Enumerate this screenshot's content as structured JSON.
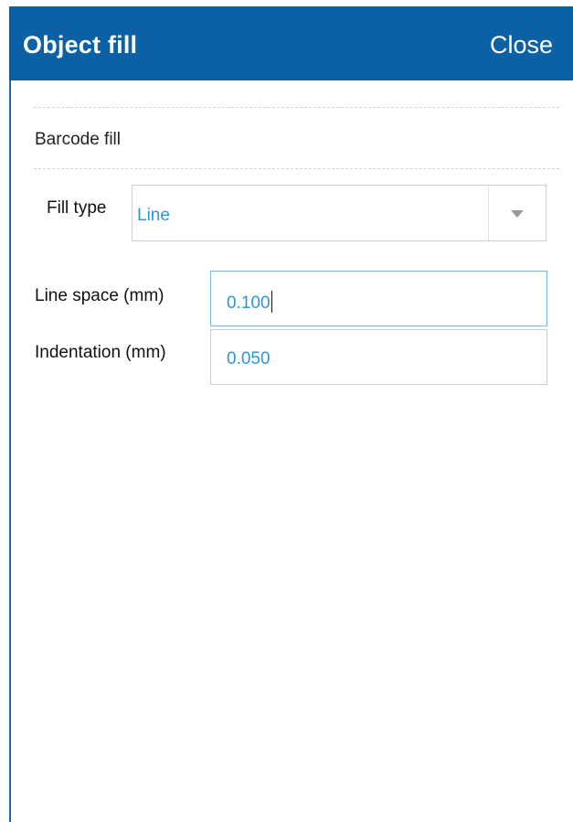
{
  "header": {
    "title": "Object fill",
    "close_label": "Close",
    "background": "#0b61a4"
  },
  "section": {
    "title": "Barcode fill"
  },
  "fill_type": {
    "label": "Fill type",
    "value": "Line",
    "dropdown_icon": "chevron-down-icon"
  },
  "line_space": {
    "label": "Line space (mm)",
    "value": "0.100"
  },
  "indentation": {
    "label": "Indentation (mm)",
    "value": "0.050"
  },
  "colors": {
    "value_text": "#2b96d6",
    "focus_border": "#7ab8e4"
  }
}
